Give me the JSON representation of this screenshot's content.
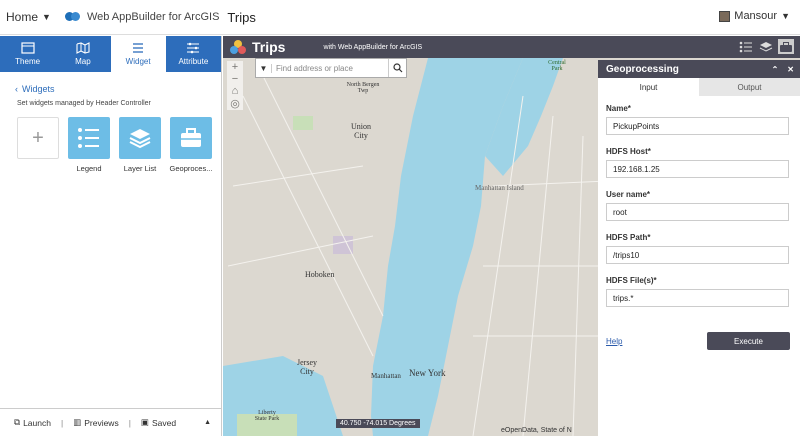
{
  "topbar": {
    "home_label": "Home",
    "builder_label": "Web AppBuilder for ArcGIS",
    "app_title": "Trips",
    "user_name": "Mansour"
  },
  "left_panel": {
    "tabs": [
      {
        "label": "Theme",
        "icon": "theme-icon",
        "active": false
      },
      {
        "label": "Map",
        "icon": "map-icon",
        "active": false
      },
      {
        "label": "Widget",
        "icon": "widget-icon",
        "active": true
      },
      {
        "label": "Attribute",
        "icon": "attribute-icon",
        "active": false
      }
    ],
    "widgets_title": "Widgets",
    "widgets_subtitle": "Set widgets managed by Header Controller",
    "widgets": [
      {
        "label": "",
        "icon": "plus-icon"
      },
      {
        "label": "Legend",
        "icon": "legend-icon"
      },
      {
        "label": "Layer List",
        "icon": "layers-icon"
      },
      {
        "label": "Geoproces...",
        "icon": "toolbox-icon"
      }
    ],
    "bottom": {
      "launch_label": "Launch",
      "previews_label": "Previews",
      "saved_label": "Saved"
    }
  },
  "map": {
    "app_name": "Trips",
    "subtitle": "with Web AppBuilder for ArcGIS",
    "search_placeholder": "Find address or place",
    "labels": {
      "union_city": "Union City",
      "hoboken": "Hoboken",
      "jersey_city": "Jersey City",
      "new_york": "New York",
      "manhattan": "Manhattan",
      "manhattan_island": "Manhattan Island",
      "central_park": "Central Park",
      "north_bergen": "North Bergen Twp",
      "liberty_park": "Liberty State Park"
    },
    "coords_text": "40.750 -74.015 Degrees",
    "attribution": "eOpenData, State of N"
  },
  "geoprocessing": {
    "title": "Geoprocessing",
    "tab_input": "Input",
    "tab_output": "Output",
    "fields": [
      {
        "label": "Name*",
        "value": "PickupPoints"
      },
      {
        "label": "HDFS Host*",
        "value": "192.168.1.25"
      },
      {
        "label": "User name*",
        "value": "root"
      },
      {
        "label": "HDFS Path*",
        "value": "/trips10"
      },
      {
        "label": "HDFS File(s)*",
        "value": "trips.*"
      }
    ],
    "help_label": "Help",
    "execute_label": "Execute"
  },
  "colors": {
    "header_dark": "#4a4a58",
    "tab_blue": "#2d6dbb",
    "widget_blue": "#6dbde6",
    "water": "#9ed3e6",
    "land": "#d9d6cf"
  }
}
